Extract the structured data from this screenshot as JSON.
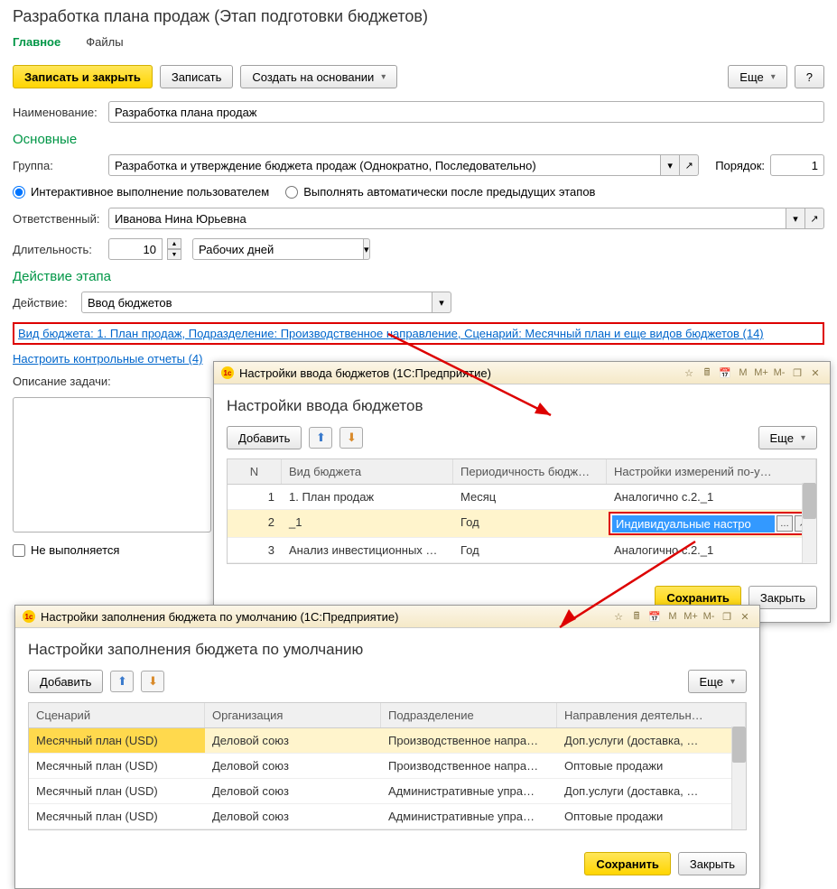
{
  "page": {
    "title": "Разработка плана продаж (Этап подготовки бюджетов)"
  },
  "tabs": {
    "main": "Главное",
    "files": "Файлы"
  },
  "toolbar": {
    "save_close": "Записать и закрыть",
    "save": "Записать",
    "create_based": "Создать на основании",
    "more": "Еще",
    "help": "?"
  },
  "fields": {
    "name_label": "Наименование:",
    "name_value": "Разработка плана продаж",
    "section_main": "Основные",
    "group_label": "Группа:",
    "group_value": "Разработка и утверждение бюджета продаж (Однократно, Последовательно)",
    "order_label": "Порядок:",
    "order_value": "1",
    "radio_interactive": "Интерактивное выполнение пользователем",
    "radio_auto": "Выполнять автоматически после предыдущих этапов",
    "responsible_label": "Ответственный:",
    "responsible_value": "Иванова Нина Юрьевна",
    "duration_label": "Длительность:",
    "duration_value": "10",
    "duration_unit": "Рабочих дней",
    "section_action": "Действие этапа",
    "action_label": "Действие:",
    "action_value": "Ввод бюджетов",
    "budget_link": "Вид бюджета: 1. План продаж, Подразделение: Производственное направление, Сценарий: Месячный план и еще видов бюджетов (14)",
    "reports_link": "Настроить контрольные отчеты (4)",
    "task_desc_label": "Описание задачи:",
    "not_done": "Не выполняется"
  },
  "dialog1": {
    "window_title": "Настройки ввода бюджетов  (1С:Предприятие)",
    "heading": "Настройки ввода бюджетов",
    "add": "Добавить",
    "more": "Еще",
    "cols": {
      "n": "N",
      "budget": "Вид бюджета",
      "period": "Периодичность бюдж…",
      "settings": "Настройки измерений по-у…"
    },
    "rows": [
      {
        "n": "1",
        "budget": "1. План продаж",
        "period": "Месяц",
        "settings": "Аналогично с.2._1"
      },
      {
        "n": "2",
        "budget": "_1",
        "period": "Год",
        "settings": "Индивидуальные настро"
      },
      {
        "n": "3",
        "budget": "Анализ инвестиционных …",
        "period": "Год",
        "settings": "Аналогично с.2._1"
      }
    ],
    "save": "Сохранить",
    "close": "Закрыть"
  },
  "dialog2": {
    "window_title": "Настройки заполнения бюджета по умолчанию  (1С:Предприятие)",
    "heading": "Настройки заполнения бюджета по умолчанию",
    "add": "Добавить",
    "more": "Еще",
    "cols": {
      "scenario": "Сценарий",
      "org": "Организация",
      "dept": "Подразделение",
      "dir": "Направления деятельн…"
    },
    "rows": [
      {
        "scenario": "Месячный план (USD)",
        "org": "Деловой союз",
        "dept": "Производственное напра…",
        "dir": "Доп.услуги (доставка, …"
      },
      {
        "scenario": "Месячный план (USD)",
        "org": "Деловой союз",
        "dept": "Производственное напра…",
        "dir": "Оптовые продажи"
      },
      {
        "scenario": "Месячный план (USD)",
        "org": "Деловой союз",
        "dept": "Административные упра…",
        "dir": "Доп.услуги (доставка, …"
      },
      {
        "scenario": "Месячный план (USD)",
        "org": "Деловой союз",
        "dept": "Административные упра…",
        "dir": "Оптовые продажи"
      }
    ],
    "save": "Сохранить",
    "close": "Закрыть"
  },
  "title_icons": {
    "m": "M",
    "mp": "M+",
    "mm": "M-"
  }
}
